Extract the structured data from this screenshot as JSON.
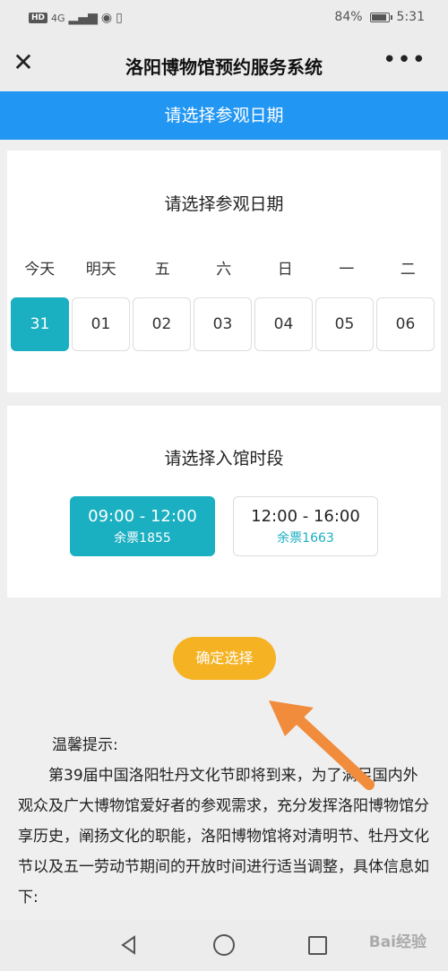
{
  "status_bar": {
    "left_chip": "HD",
    "network": "4G",
    "battery_percent": "84%",
    "time": "5:31"
  },
  "nav": {
    "title": "洛阳博物馆预约服务系统"
  },
  "banner": {
    "text": "请选择参观日期"
  },
  "date_card": {
    "title": "请选择参观日期",
    "weekdays": [
      "今天",
      "明天",
      "五",
      "六",
      "日",
      "一",
      "二"
    ],
    "days": [
      "31",
      "01",
      "02",
      "03",
      "04",
      "05",
      "06"
    ],
    "selected_index": 0
  },
  "time_card": {
    "title": "请选择入馆时段",
    "slots": [
      {
        "time": "09:00 - 12:00",
        "remaining": "余票1855"
      },
      {
        "time": "12:00 - 16:00",
        "remaining": "余票1663"
      }
    ],
    "selected_index": 0
  },
  "confirm": {
    "label": "确定选择"
  },
  "tips": {
    "heading": "温馨提示:",
    "body": "第39届中国洛阳牡丹文化节即将到来，为了满足国内外观众及广大博物馆爱好者的参观需求，充分发挥洛阳博物馆分享历史，阐扬文化的职能，洛阳博物馆将对清明节、牡丹文化节以及五一劳动节期间的开放时间进行适当调整，具体信息如下:"
  },
  "watermark": "Bai经验",
  "colors": {
    "banner": "#2196f3",
    "selected": "#1aafc1",
    "confirm": "#f5b323",
    "arrow": "#f08c3c"
  }
}
